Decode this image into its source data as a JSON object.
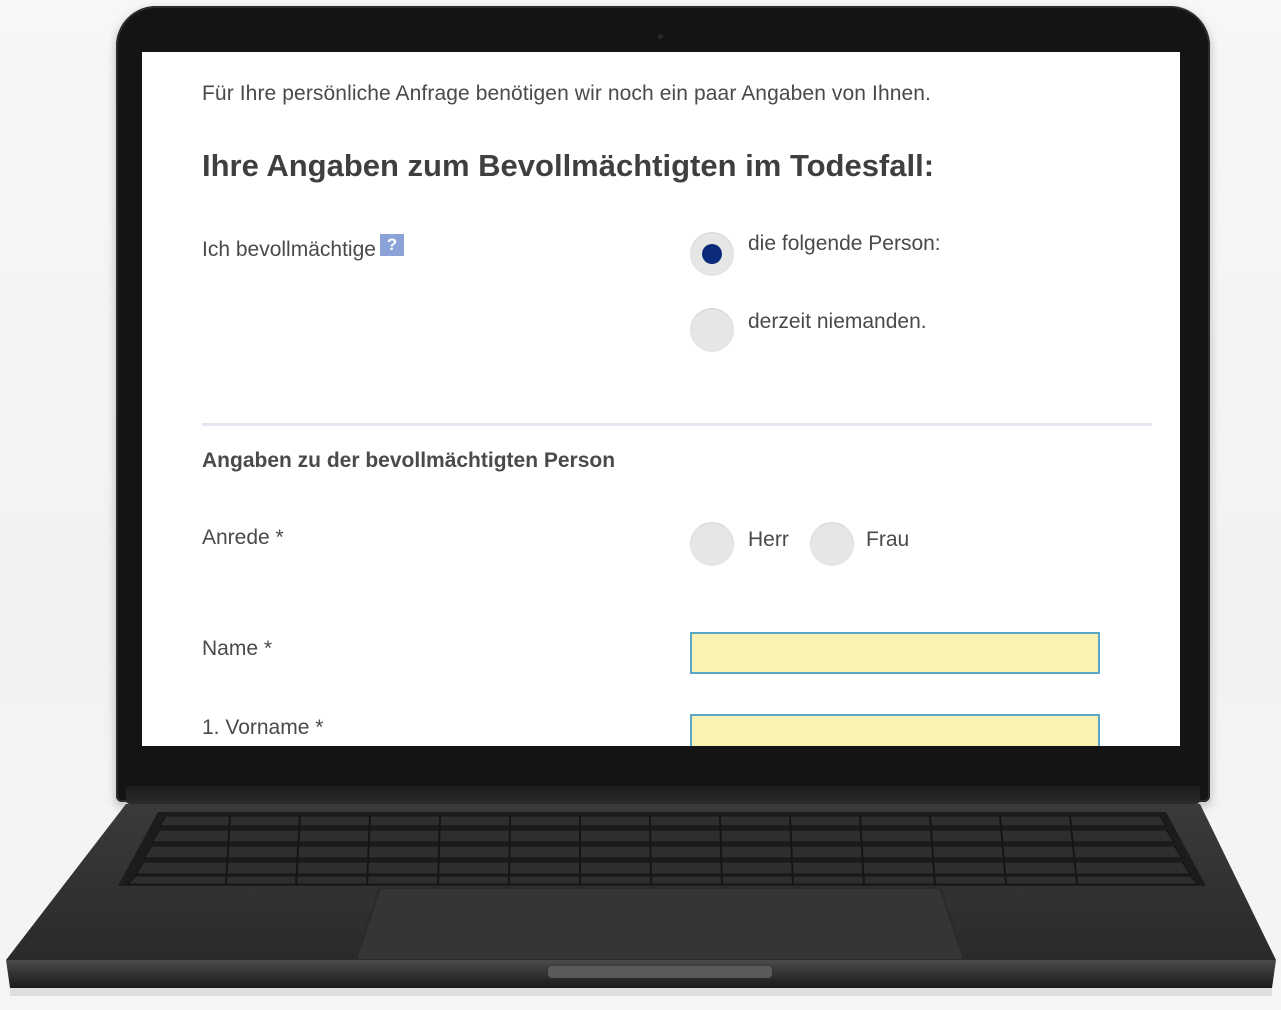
{
  "form": {
    "intro_text": "Für Ihre persönliche Anfrage benötigen wir noch ein paar Angaben von Ihnen.",
    "section_title": "Ihre Angaben zum Bevollmächtigten im Todesfall:",
    "authorize": {
      "label": "Ich bevollmächtige",
      "help_icon": "?",
      "options": [
        {
          "label": "die folgende Person:",
          "selected": true
        },
        {
          "label": "derzeit niemanden.",
          "selected": false
        }
      ]
    },
    "person_heading": "Angaben zu der bevollmächtigten Person",
    "salutation": {
      "label": "Anrede *",
      "options": [
        {
          "label": "Herr",
          "selected": false
        },
        {
          "label": "Frau",
          "selected": false
        }
      ]
    },
    "name": {
      "label": "Name *",
      "value": ""
    },
    "first_name": {
      "label": "1. Vorname *",
      "value": ""
    }
  },
  "colors": {
    "input_background": "#f8f3b2",
    "input_border": "#5aa8c8",
    "radio_selected": "#0b2a7a",
    "help_icon": "#8aa2d8"
  }
}
